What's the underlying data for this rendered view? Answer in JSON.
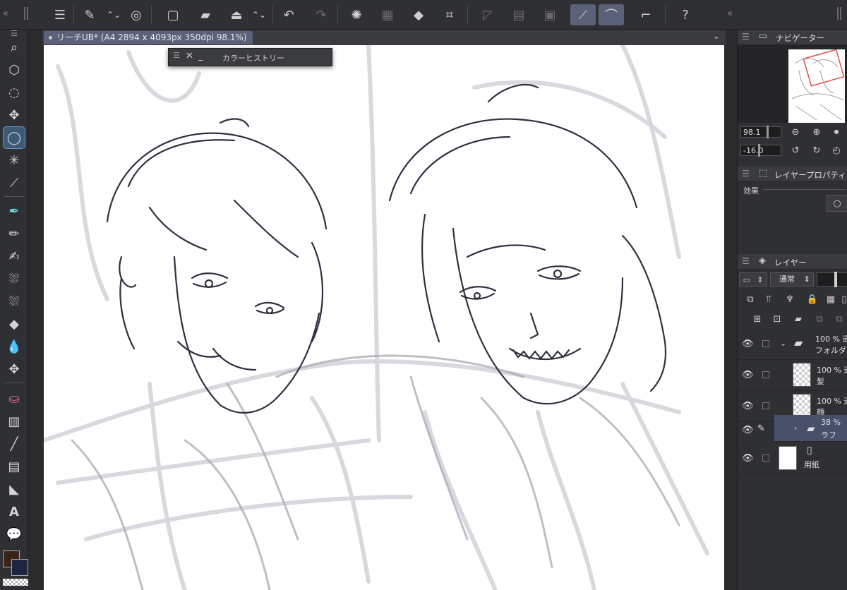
{
  "document": {
    "tab_title": "リーチUB* (A4 2894 x 4093px 350dpi 98.1%)"
  },
  "color_history": {
    "title": "カラーヒストリー"
  },
  "navigator": {
    "title": "ナビゲーター",
    "zoom_value": "98.1",
    "rotation_value": "-16.0"
  },
  "layer_property": {
    "title": "レイヤープロパティ",
    "effect_label": "効果"
  },
  "layers": {
    "title": "レイヤー",
    "blend_mode": "通常",
    "items": [
      {
        "pct": "100 % 通",
        "name": "フォルダ",
        "type": "folder",
        "expanded": true
      },
      {
        "pct": "100 % 通",
        "name": "髪",
        "type": "raster"
      },
      {
        "pct": "100 % 通",
        "name": "顔",
        "type": "raster"
      },
      {
        "pct": "38 %",
        "name": "ラフ",
        "type": "folder",
        "expanded": false,
        "selected": true
      },
      {
        "pct": "",
        "name": "用紙",
        "type": "paper"
      }
    ]
  },
  "colors": {
    "main_color": "#3a2418",
    "sub_color": "#1d2540",
    "accent": "#5a6178"
  }
}
